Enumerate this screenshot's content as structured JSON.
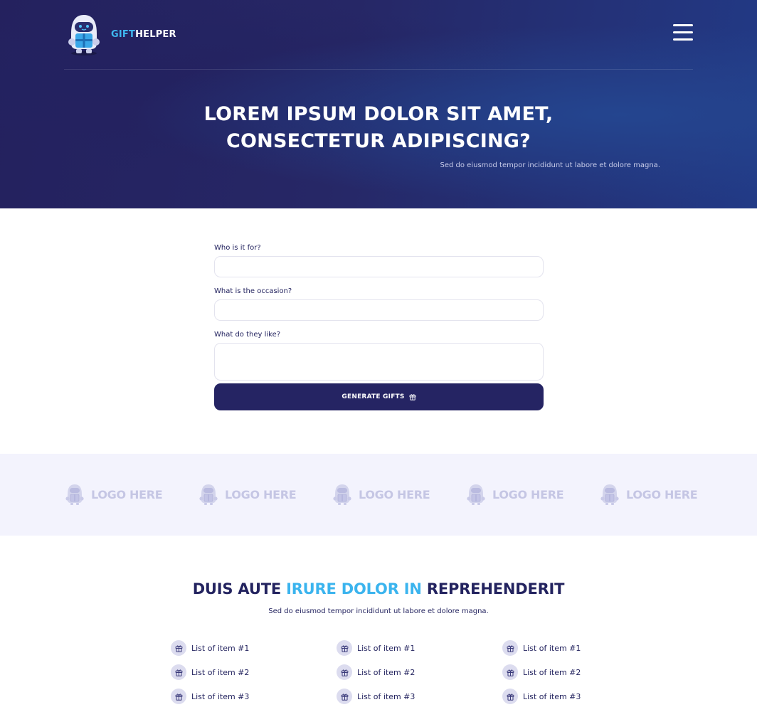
{
  "header": {
    "brand_part1": "GIFT",
    "brand_part2": "HELPER",
    "menu_icon": "hamburger-menu-icon"
  },
  "hero": {
    "title_line1": "LOREM IPSUM DOLOR SIT AMET,",
    "title_line2": "CONSECTETUR ADIPISCING?",
    "subtitle": "Sed do eiusmod tempor incididunt ut labore et dolore magna."
  },
  "form": {
    "recipient_label": "Who is it for?",
    "recipient_value": "",
    "occasion_label": "What is the occasion?",
    "occasion_value": "",
    "likes_label": "What do they like?",
    "likes_value": "",
    "submit_label": "GENERATE GIFTS",
    "submit_icon": "gift-icon"
  },
  "partners": {
    "logos": [
      "LOGO HERE",
      "LOGO HERE",
      "LOGO HERE",
      "LOGO HERE",
      "LOGO HERE"
    ]
  },
  "features": {
    "title_part1": "DUIS AUTE ",
    "title_accent": "IRURE DOLOR IN",
    "title_part2": " REPREHENDERIT",
    "subtitle": "Sed do eiusmod tempor incididunt ut labore et dolore magna.",
    "columns": [
      [
        "List of item #1",
        "List of item #2",
        "List of item #3"
      ],
      [
        "List of item #1",
        "List of item #2",
        "List of item #3"
      ],
      [
        "List of item #1",
        "List of item #2",
        "List of item #3"
      ]
    ]
  },
  "colors": {
    "hero_bg": "#252463",
    "accent": "#3bb4ee",
    "button": "#252463",
    "logo_strip_bg": "#f3f3fd"
  }
}
